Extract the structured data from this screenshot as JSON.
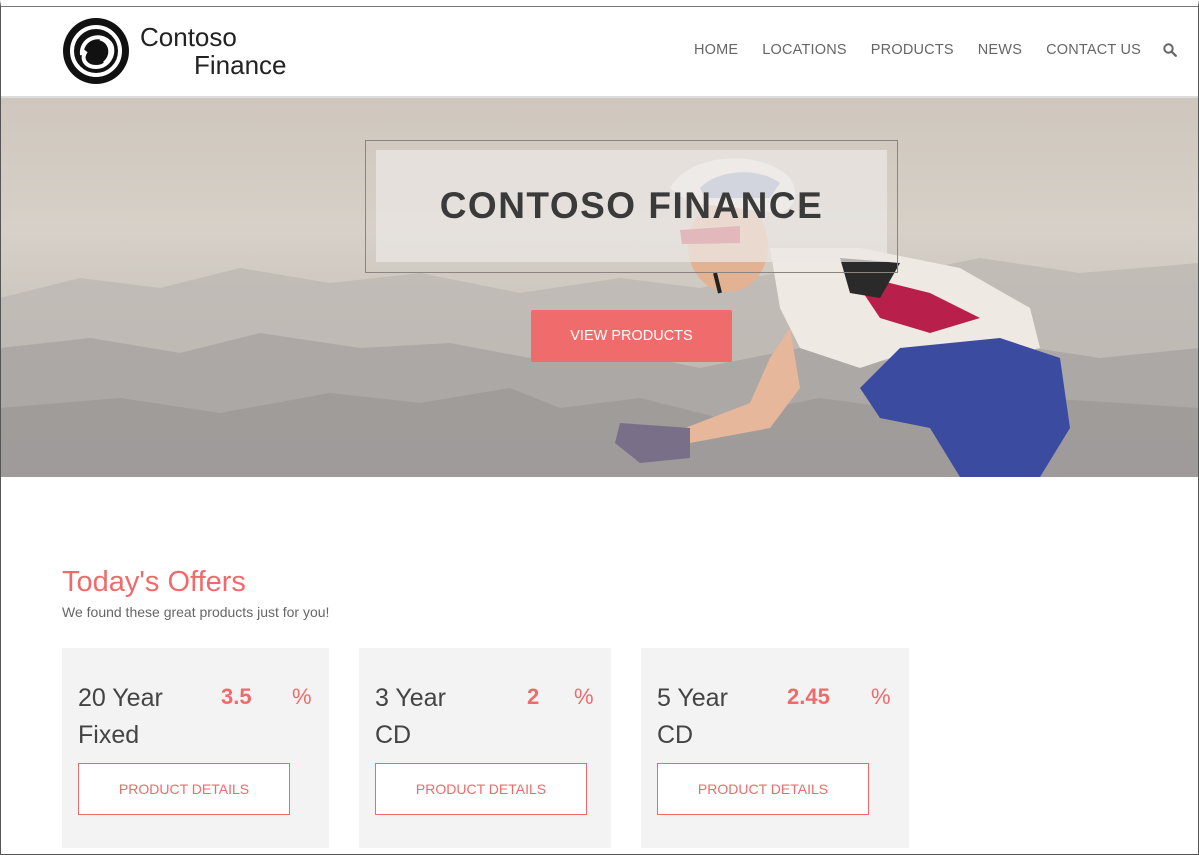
{
  "brand": {
    "name_line1": "Contoso",
    "name_line2": "Finance"
  },
  "nav": {
    "items": [
      "HOME",
      "LOCATIONS",
      "PRODUCTS",
      "NEWS",
      "CONTACT US"
    ],
    "search_icon": "search-icon"
  },
  "hero": {
    "title": "CONTOSO FINANCE",
    "button_label": "VIEW PRODUCTS"
  },
  "offers": {
    "title": "Today's Offers",
    "subtitle": "We found these great products just for you!",
    "cards": [
      {
        "name": "20 Year Fixed",
        "rate": "3.5",
        "unit": "%",
        "button_label": "PRODUCT DETAILS"
      },
      {
        "name": "3 Year CD",
        "rate": "2",
        "unit": "%",
        "button_label": "PRODUCT DETAILS"
      },
      {
        "name": "5 Year CD",
        "rate": "2.45",
        "unit": "%",
        "button_label": "PRODUCT DETAILS"
      }
    ]
  },
  "colors": {
    "accent": "#ef6b6b",
    "card_bg": "#f3f3f3",
    "text": "#444444"
  }
}
